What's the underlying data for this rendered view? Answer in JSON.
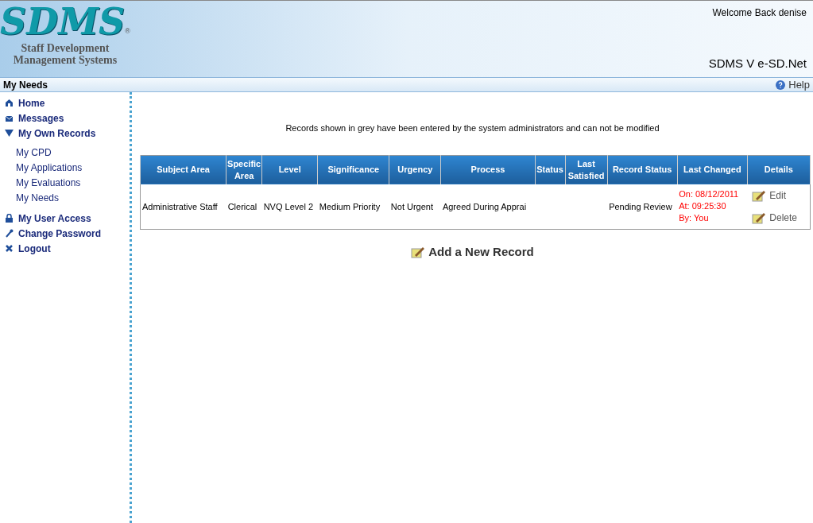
{
  "header": {
    "logo": "SDMS",
    "logo_mark": "®",
    "tagline_1": "Staff Development",
    "tagline_2": "Management Systems",
    "welcome": "Welcome Back denise",
    "product": "SDMS V e-SD.Net"
  },
  "subbar": {
    "title": "My Needs",
    "help": "Help"
  },
  "sidebar": {
    "items": [
      {
        "label": "Home",
        "kind": "link"
      },
      {
        "label": "Messages",
        "kind": "link"
      },
      {
        "label": "My Own Records",
        "kind": "group",
        "expanded": true,
        "children": [
          {
            "label": "My CPD"
          },
          {
            "label": "My Applications"
          },
          {
            "label": "My Evaluations"
          },
          {
            "label": "My Needs"
          }
        ]
      },
      {
        "label": "My User Access",
        "kind": "link"
      },
      {
        "label": "Change Password",
        "kind": "link"
      },
      {
        "label": "Logout",
        "kind": "link"
      }
    ]
  },
  "notice": "Records shown in grey have been entered by the system administrators and can not be modified",
  "table": {
    "columns": [
      "Subject Area",
      "Specific Area",
      "Level",
      "Significance",
      "Urgency",
      "Process",
      "Status",
      "Last Satisfied",
      "Record Status",
      "Last Changed",
      "Details"
    ],
    "rows": [
      {
        "cells": [
          "Administrative Staff",
          "Clerical",
          "NVQ Level 2",
          "Medium Priority",
          "Not Urgent",
          "Agreed During Apprai",
          "",
          "",
          "Pending Review"
        ],
        "changed": [
          "On: 08/12/2011",
          "At: 09:25:30",
          "By: You"
        ],
        "actions": [
          "Edit",
          "Delete"
        ],
        "grey": false
      }
    ]
  },
  "add_button": "Add a New Record"
}
